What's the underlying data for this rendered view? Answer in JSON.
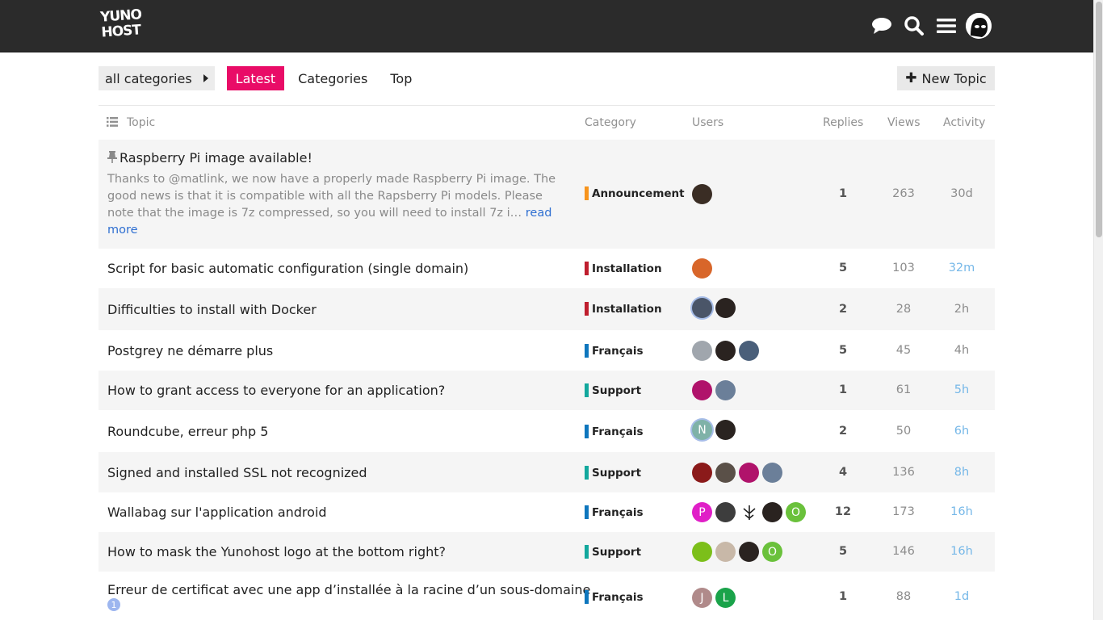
{
  "header": {
    "logo_line1": "YUNO",
    "logo_line2": "HOST",
    "icons": [
      "chat-icon",
      "search-icon",
      "hamburger-menu-icon",
      "user-avatar"
    ]
  },
  "nav": {
    "category_dropdown": "all categories",
    "tabs": [
      "Latest",
      "Categories",
      "Top"
    ],
    "active_tab": "Latest",
    "new_topic": "New Topic"
  },
  "columns": {
    "topic": "Topic",
    "category": "Category",
    "users": "Users",
    "replies": "Replies",
    "views": "Views",
    "activity": "Activity"
  },
  "colors": {
    "accent": "#e90c67",
    "announcement": "#f7941d",
    "installation": "#bf1e2e",
    "francais": "#0e76bd",
    "support": "#12a89d",
    "fresh_activity": "#76b8e8",
    "read_more_link": "#2f6fd1"
  },
  "topics": [
    {
      "title": "Raspberry Pi image available!",
      "pinned": true,
      "excerpt": "Thanks to @matlink, we now have a properly made Raspberry Pi image. The good news is that it is compatible with all the Rapsberry Pi models. Please note that the image is 7z compressed, so you will need to install 7z i…",
      "read_more": "read more",
      "category": "Announcement",
      "replies": "1",
      "views": "263",
      "activity": "30d"
    },
    {
      "title": "Script for basic automatic configuration (single domain)",
      "category": "Installation",
      "replies": "5",
      "views": "103",
      "activity": "32m"
    },
    {
      "title": "Difficulties to install with Docker",
      "category": "Installation",
      "replies": "2",
      "views": "28",
      "activity": "2h"
    },
    {
      "title": "Postgrey ne démarre plus",
      "category": "Français",
      "replies": "5",
      "views": "45",
      "activity": "4h"
    },
    {
      "title": "How to grant access to everyone for an application?",
      "category": "Support",
      "replies": "1",
      "views": "61",
      "activity": "5h"
    },
    {
      "title": "Roundcube, erreur php 5",
      "category": "Français",
      "replies": "2",
      "views": "50",
      "activity": "6h",
      "avatar_letters": [
        "N"
      ]
    },
    {
      "title": "Signed and installed SSL not recognized",
      "category": "Support",
      "replies": "4",
      "views": "136",
      "activity": "8h"
    },
    {
      "title": "Wallabag sur l'application android",
      "category": "Français",
      "replies": "12",
      "views": "173",
      "activity": "16h",
      "avatar_letters": [
        "P",
        "O"
      ]
    },
    {
      "title": "How to mask the Yunohost logo at the bottom right?",
      "category": "Support",
      "replies": "5",
      "views": "146",
      "activity": "16h",
      "avatar_letters": [
        "O"
      ]
    },
    {
      "title": "Erreur de certificat avec une app d’installée à la racine d’un sous-domaine",
      "unread_badge": "1",
      "category": "Français",
      "replies": "1",
      "views": "88",
      "activity": "1d",
      "avatar_letters": [
        "J",
        "L"
      ]
    }
  ]
}
